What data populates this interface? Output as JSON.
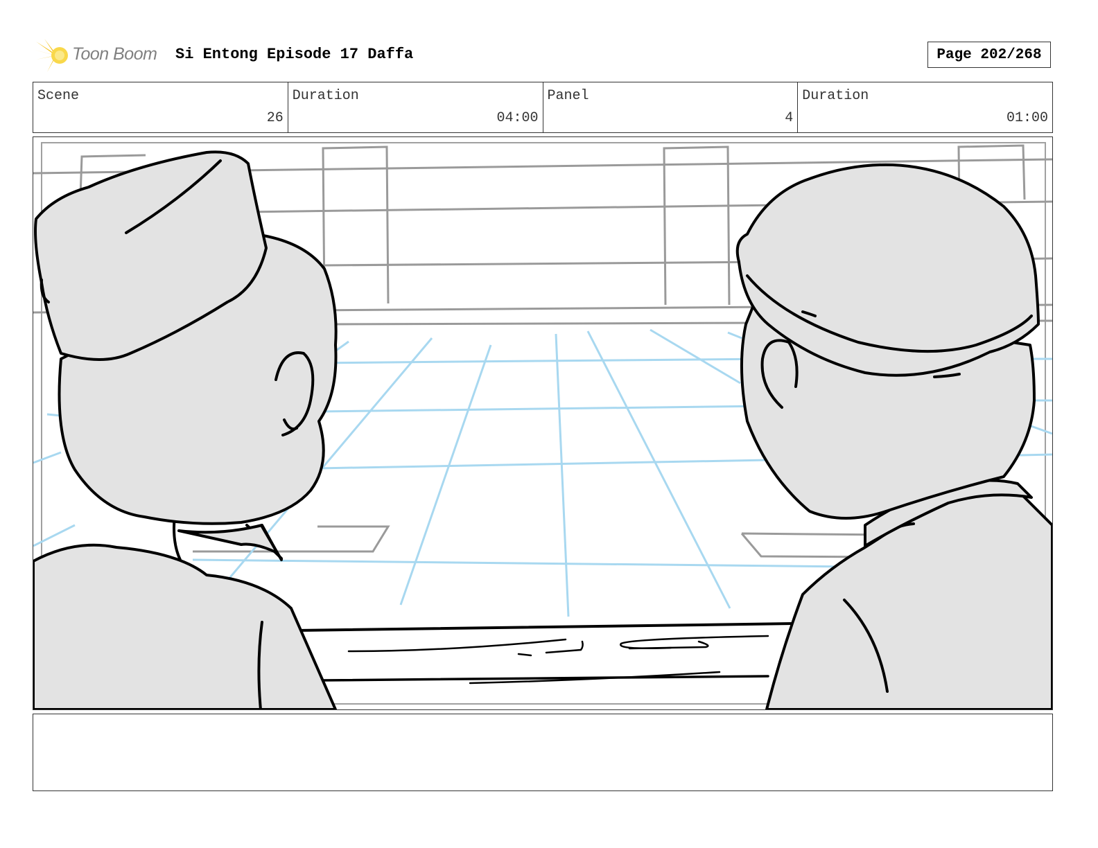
{
  "header": {
    "logo_text": "Toon Boom",
    "title": "Si Entong Episode 17 Daffa",
    "page_label": "Page 202/268"
  },
  "info": {
    "scene_label": "Scene",
    "scene_value": "26",
    "scene_duration_label": "Duration",
    "scene_duration_value": "04:00",
    "panel_label": "Panel",
    "panel_value": "4",
    "panel_duration_label": "Duration",
    "panel_duration_value": "01:00"
  },
  "panel": {
    "sketch_colors": {
      "line": "#000000",
      "fill": "#e3e3e3",
      "grid": "#a8d8f0",
      "structure": "#999999"
    }
  },
  "notes": {
    "text": ""
  }
}
